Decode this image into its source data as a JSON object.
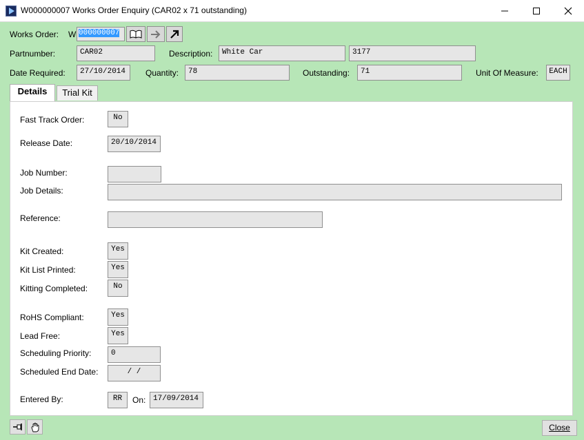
{
  "window": {
    "title": "W000000007 Works Order Enquiry (CAR02 x 71 outstanding)",
    "minimize_icon": "minimize-icon",
    "maximize_icon": "maximize-icon",
    "close_icon": "close-icon"
  },
  "header": {
    "works_order_label": "Works Order:",
    "works_order_prefix": "W",
    "works_order_value": "000000007",
    "partnumber_label": "Partnumber:",
    "partnumber_value": "CAR02",
    "description_label": "Description:",
    "description_value": "White Car",
    "description_extra": "3177",
    "date_required_label": "Date Required:",
    "date_required_value": "27/10/2014",
    "quantity_label": "Quantity:",
    "quantity_value": "78",
    "outstanding_label": "Outstanding:",
    "outstanding_value": "71",
    "uom_label": "Unit Of Measure:",
    "uom_value": "EACH"
  },
  "tabs": [
    {
      "label": "Details",
      "active": true
    },
    {
      "label": "Trial Kit",
      "active": false
    }
  ],
  "details": {
    "fast_track_label": "Fast Track Order:",
    "fast_track_value": "No",
    "release_date_label": "Release Date:",
    "release_date_value": "20/10/2014",
    "job_number_label": "Job Number:",
    "job_number_value": "",
    "job_details_label": "Job Details:",
    "job_details_value": "",
    "reference_label": "Reference:",
    "reference_value": "",
    "kit_created_label": "Kit Created:",
    "kit_created_value": "Yes",
    "kit_list_printed_label": "Kit List Printed:",
    "kit_list_printed_value": "Yes",
    "kitting_completed_label": "Kitting Completed:",
    "kitting_completed_value": "No",
    "rohs_label": "RoHS Compliant:",
    "rohs_value": "Yes",
    "lead_free_label": "Lead Free:",
    "lead_free_value": "Yes",
    "scheduling_priority_label": "Scheduling Priority:",
    "scheduling_priority_value": "0",
    "scheduled_end_label": "Scheduled End Date:",
    "scheduled_end_value": "/  /",
    "entered_by_label": "Entered By:",
    "entered_by_value": "RR",
    "on_label": "On:",
    "on_value": "17/09/2014"
  },
  "footer": {
    "close_label": "Close"
  },
  "colors": {
    "background": "#b7e6b7",
    "selection": "#3399ff",
    "field": "#e6e6e6"
  }
}
